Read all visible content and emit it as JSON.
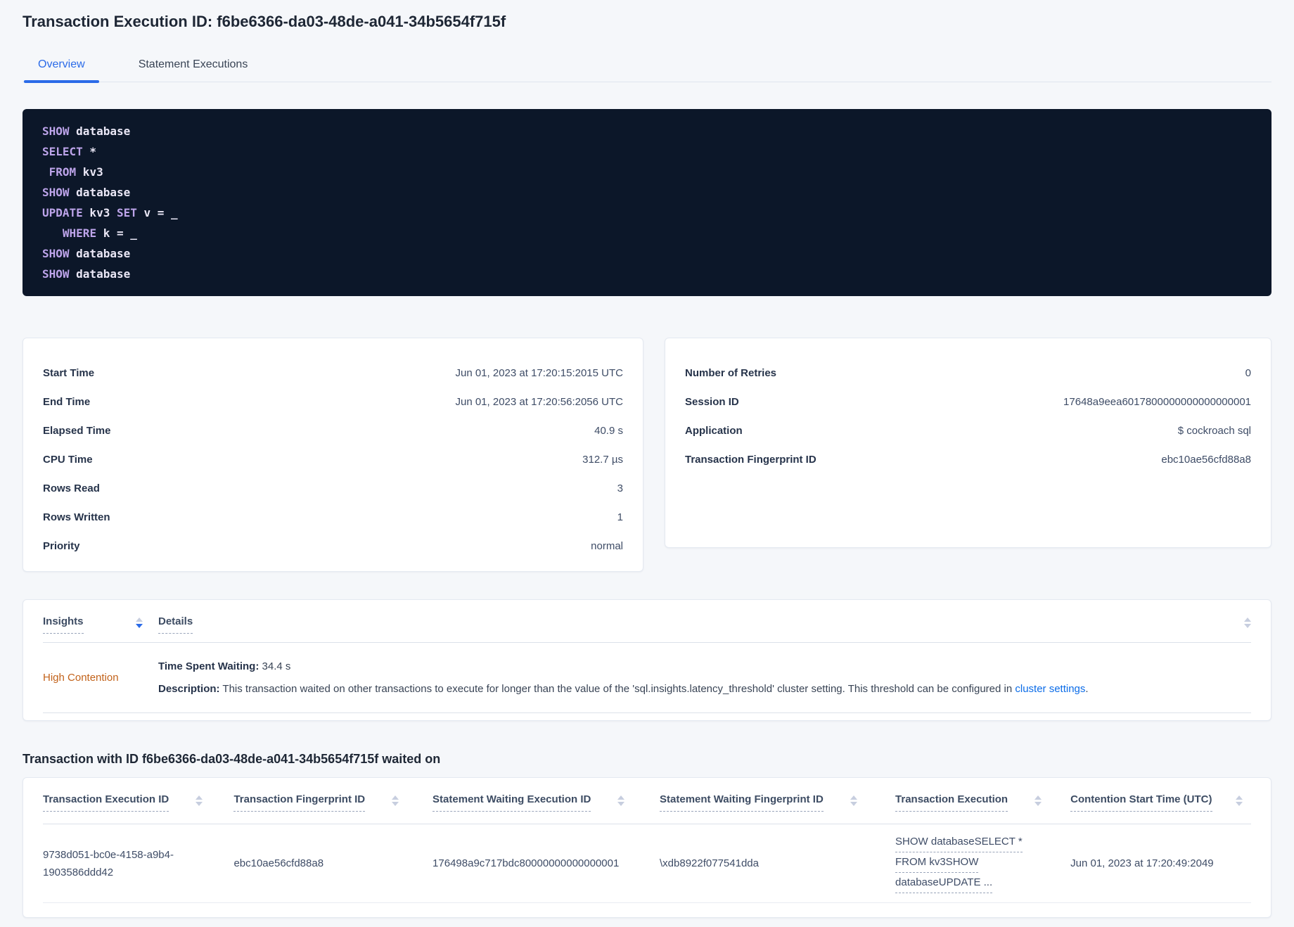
{
  "header": {
    "title": "Transaction Execution ID: f6be6366-da03-48de-a041-34b5654f715f",
    "tabs": [
      {
        "label": "Overview"
      },
      {
        "label": "Statement Executions"
      }
    ]
  },
  "sql": {
    "lines": [
      {
        "segments": [
          {
            "text": "SHOW",
            "style": "keyword"
          },
          {
            "text": " database",
            "style": "plain"
          }
        ]
      },
      {
        "segments": [
          {
            "text": "SELECT",
            "style": "keyword"
          },
          {
            "text": " *",
            "style": "plain"
          }
        ]
      },
      {
        "segments": [
          {
            "text": " ",
            "style": "plain"
          },
          {
            "text": "FROM",
            "style": "keyword"
          },
          {
            "text": " kv3",
            "style": "plain"
          }
        ]
      },
      {
        "segments": [
          {
            "text": "SHOW",
            "style": "keyword"
          },
          {
            "text": " database",
            "style": "plain"
          }
        ]
      },
      {
        "segments": [
          {
            "text": "UPDATE",
            "style": "keyword"
          },
          {
            "text": " kv3 ",
            "style": "plain"
          },
          {
            "text": "SET",
            "style": "keyword"
          },
          {
            "text": " v = _",
            "style": "plain"
          }
        ]
      },
      {
        "segments": [
          {
            "text": "   ",
            "style": "plain"
          },
          {
            "text": "WHERE",
            "style": "keyword"
          },
          {
            "text": " k = _",
            "style": "plain"
          }
        ]
      },
      {
        "segments": [
          {
            "text": "SHOW",
            "style": "keyword"
          },
          {
            "text": " database",
            "style": "plain"
          }
        ]
      },
      {
        "segments": [
          {
            "text": "SHOW",
            "style": "keyword"
          },
          {
            "text": " database",
            "style": "plain"
          }
        ]
      }
    ]
  },
  "summary": {
    "left": {
      "rows": [
        {
          "label": "Start Time",
          "value": "Jun 01, 2023 at 17:20:15:2015 UTC"
        },
        {
          "label": "End Time",
          "value": "Jun 01, 2023 at 17:20:56:2056 UTC"
        },
        {
          "label": "Elapsed Time",
          "value": "40.9 s"
        },
        {
          "label": "CPU Time",
          "value": "312.7 µs"
        },
        {
          "label": "Rows Read",
          "value": "3"
        },
        {
          "label": "Rows Written",
          "value": "1"
        },
        {
          "label": "Priority",
          "value": "normal"
        }
      ]
    },
    "right": {
      "rows": [
        {
          "label": "Number of Retries",
          "value": "0"
        },
        {
          "label": "Session ID",
          "value": "17648a9eea6017800000000000000001"
        },
        {
          "label": "Application",
          "value": "$ cockroach sql"
        },
        {
          "label": "Transaction Fingerprint ID",
          "value": "ebc10ae56cfd88a8"
        }
      ]
    }
  },
  "insights": {
    "columns": [
      {
        "label": "Insights"
      },
      {
        "label": "Details"
      }
    ],
    "row": {
      "insight": "High Contention",
      "waiting_label": "Time Spent Waiting:",
      "waiting_value": " 34.4 s",
      "description_label": "Description:",
      "description_text": " This transaction waited on other transactions to execute for longer than the value of the 'sql.insights.latency_threshold' cluster setting. This threshold can be configured in ",
      "description_link": "cluster settings",
      "description_end": "."
    }
  },
  "waited_on": {
    "heading": "Transaction with ID f6be6366-da03-48de-a041-34b5654f715f waited on",
    "columns": [
      {
        "label": "Transaction Execution ID"
      },
      {
        "label": "Transaction Fingerprint ID"
      },
      {
        "label": "Statement Waiting Execution ID"
      },
      {
        "label": "Statement Waiting Fingerprint ID"
      },
      {
        "label": "Transaction Execution"
      },
      {
        "label": "Contention Start Time (UTC)"
      }
    ],
    "row": {
      "transaction_execution_id": "9738d051-bc0e-4158-a9b4-1903586ddd42",
      "transaction_fingerprint_id": "ebc10ae56cfd88a8",
      "statement_waiting_execution_id": "176498a9c717bdc80000000000000001",
      "statement_waiting_fingerprint_id": "\\xdb8922f077541dda",
      "transaction_execution_lines": [
        "SHOW databaseSELECT *",
        "FROM kv3SHOW",
        "databaseUPDATE ..."
      ],
      "contention_start_time": "Jun 01, 2023 at 17:20:49:2049"
    }
  }
}
